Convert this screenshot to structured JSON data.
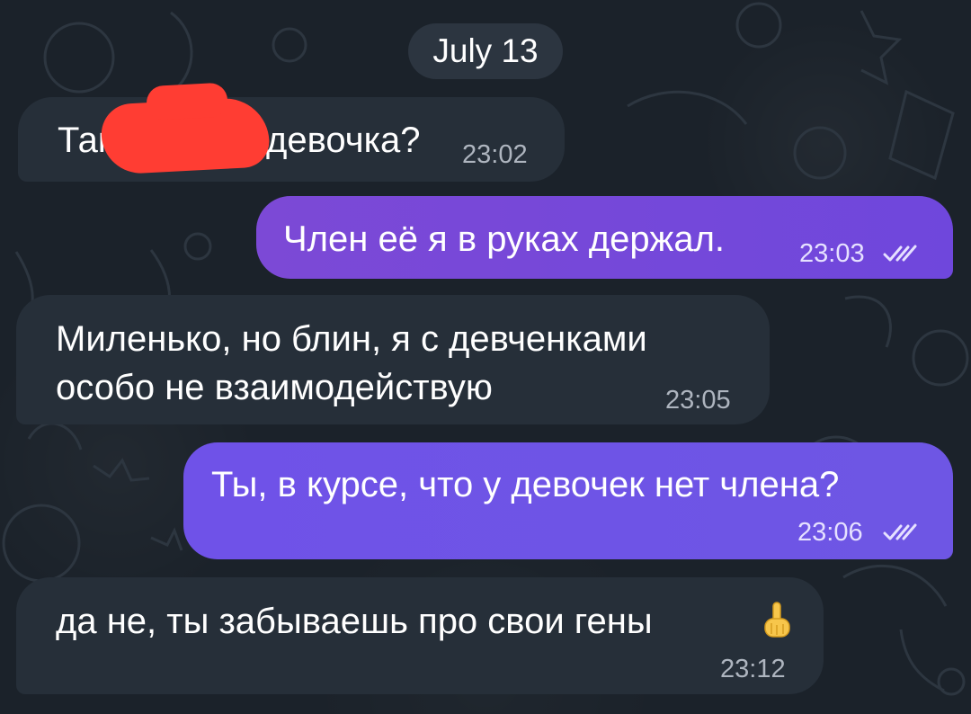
{
  "chat": {
    "date_chip": "July 13",
    "messages": [
      {
        "direction": "incoming",
        "text_before_redaction": "Так ",
        "text_after_redaction": "девочка?",
        "time": "23:02"
      },
      {
        "direction": "outgoing",
        "text": "Член её я в руках держал.",
        "time": "23:03",
        "status": "read"
      },
      {
        "direction": "incoming",
        "line1": "Миленько, но блин, я с девченками",
        "line2": "особо не взаимодействую",
        "time": "23:05"
      },
      {
        "direction": "outgoing",
        "text": "Ты, в курсе, что у девочек нет члена?",
        "time": "23:06",
        "status": "read"
      },
      {
        "direction": "incoming",
        "text": "да не, ты забываешь про свои гены",
        "emoji": "☝️",
        "time": "23:12"
      }
    ]
  },
  "colors": {
    "background": "#1b222a",
    "incoming_bubble": "#262f39",
    "outgoing_bubble_top": "#7c49d6",
    "outgoing_bubble_bottom": "#6f52e8",
    "redaction": "#ff3d33",
    "timestamp_incoming": "#aeb5bf"
  },
  "icons": {
    "read_status": "double-check-icon",
    "emoji": "pointing-up-emoji"
  }
}
